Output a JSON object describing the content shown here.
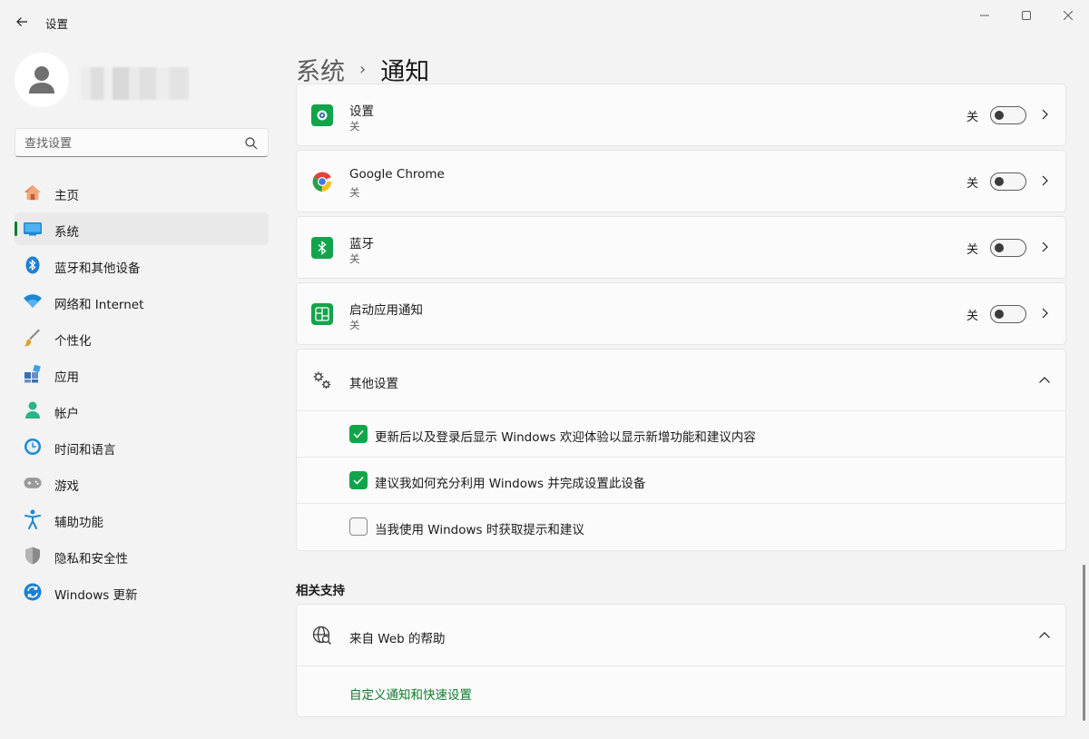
{
  "window": {
    "title": "设置",
    "back": "back",
    "minimize": "minimize",
    "maximize": "maximize",
    "close": "close"
  },
  "sidebar": {
    "search_placeholder": "查找设置",
    "items": [
      {
        "label": "主页",
        "icon": "home-icon",
        "active": false
      },
      {
        "label": "系统",
        "icon": "system-icon",
        "active": true
      },
      {
        "label": "蓝牙和其他设备",
        "icon": "bluetooth-icon",
        "active": false
      },
      {
        "label": "网络和 Internet",
        "icon": "wifi-icon",
        "active": false
      },
      {
        "label": "个性化",
        "icon": "brush-icon",
        "active": false
      },
      {
        "label": "应用",
        "icon": "apps-icon",
        "active": false
      },
      {
        "label": "帐户",
        "icon": "account-icon",
        "active": false
      },
      {
        "label": "时间和语言",
        "icon": "clock-globe-icon",
        "active": false
      },
      {
        "label": "游戏",
        "icon": "gamepad-icon",
        "active": false
      },
      {
        "label": "辅助功能",
        "icon": "accessibility-icon",
        "active": false
      },
      {
        "label": "隐私和安全性",
        "icon": "shield-icon",
        "active": false
      },
      {
        "label": "Windows 更新",
        "icon": "update-icon",
        "active": false
      }
    ]
  },
  "breadcrumb": {
    "parent": "系统",
    "separator": "›",
    "current": "通知"
  },
  "apps": [
    {
      "name": "设置",
      "status": "关",
      "toggle_label": "关",
      "toggle_on": false,
      "icon": "settings-app-icon"
    },
    {
      "name": "Google Chrome",
      "status": "关",
      "toggle_label": "关",
      "toggle_on": false,
      "icon": "chrome-icon"
    },
    {
      "name": "蓝牙",
      "status": "关",
      "toggle_label": "关",
      "toggle_on": false,
      "icon": "bluetooth-app-icon"
    },
    {
      "name": "启动应用通知",
      "status": "关",
      "toggle_label": "关",
      "toggle_on": false,
      "icon": "startup-apps-icon"
    }
  ],
  "other_settings": {
    "label": "其他设置",
    "options": [
      {
        "label": "更新后以及登录后显示 Windows 欢迎体验以显示新增功能和建议内容",
        "checked": true
      },
      {
        "label": "建议我如何充分利用 Windows 并完成设置此设备",
        "checked": true
      },
      {
        "label": "当我使用 Windows 时获取提示和建议",
        "checked": false
      }
    ]
  },
  "related": {
    "title": "相关支持",
    "web_help_label": "来自 Web 的帮助",
    "link": "自定义通知和快速设置"
  },
  "colors": {
    "accent": "#0f7b2f",
    "checkbox": "#12a44a",
    "background": "#f3f3f3",
    "card": "#fbfbfb"
  }
}
